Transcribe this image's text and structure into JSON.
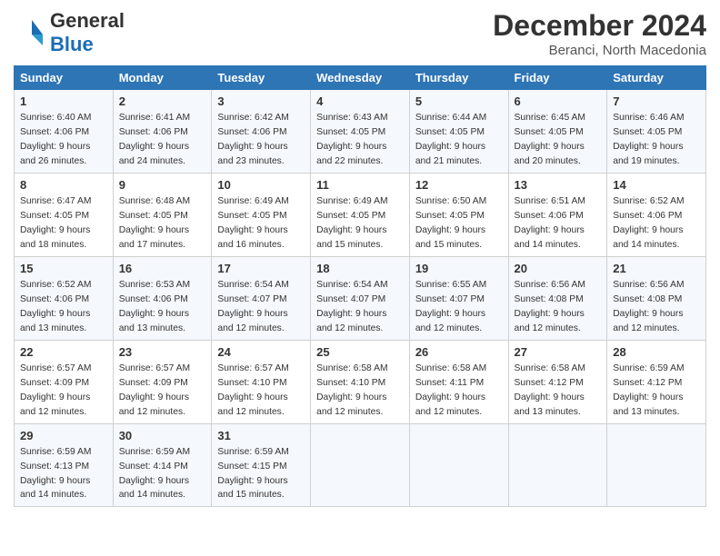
{
  "header": {
    "logo_general": "General",
    "logo_blue": "Blue",
    "month_year": "December 2024",
    "location": "Beranci, North Macedonia"
  },
  "days_of_week": [
    "Sunday",
    "Monday",
    "Tuesday",
    "Wednesday",
    "Thursday",
    "Friday",
    "Saturday"
  ],
  "weeks": [
    [
      {
        "day": "1",
        "sunrise": "Sunrise: 6:40 AM",
        "sunset": "Sunset: 4:06 PM",
        "daylight": "Daylight: 9 hours and 26 minutes."
      },
      {
        "day": "2",
        "sunrise": "Sunrise: 6:41 AM",
        "sunset": "Sunset: 4:06 PM",
        "daylight": "Daylight: 9 hours and 24 minutes."
      },
      {
        "day": "3",
        "sunrise": "Sunrise: 6:42 AM",
        "sunset": "Sunset: 4:06 PM",
        "daylight": "Daylight: 9 hours and 23 minutes."
      },
      {
        "day": "4",
        "sunrise": "Sunrise: 6:43 AM",
        "sunset": "Sunset: 4:05 PM",
        "daylight": "Daylight: 9 hours and 22 minutes."
      },
      {
        "day": "5",
        "sunrise": "Sunrise: 6:44 AM",
        "sunset": "Sunset: 4:05 PM",
        "daylight": "Daylight: 9 hours and 21 minutes."
      },
      {
        "day": "6",
        "sunrise": "Sunrise: 6:45 AM",
        "sunset": "Sunset: 4:05 PM",
        "daylight": "Daylight: 9 hours and 20 minutes."
      },
      {
        "day": "7",
        "sunrise": "Sunrise: 6:46 AM",
        "sunset": "Sunset: 4:05 PM",
        "daylight": "Daylight: 9 hours and 19 minutes."
      }
    ],
    [
      {
        "day": "8",
        "sunrise": "Sunrise: 6:47 AM",
        "sunset": "Sunset: 4:05 PM",
        "daylight": "Daylight: 9 hours and 18 minutes."
      },
      {
        "day": "9",
        "sunrise": "Sunrise: 6:48 AM",
        "sunset": "Sunset: 4:05 PM",
        "daylight": "Daylight: 9 hours and 17 minutes."
      },
      {
        "day": "10",
        "sunrise": "Sunrise: 6:49 AM",
        "sunset": "Sunset: 4:05 PM",
        "daylight": "Daylight: 9 hours and 16 minutes."
      },
      {
        "day": "11",
        "sunrise": "Sunrise: 6:49 AM",
        "sunset": "Sunset: 4:05 PM",
        "daylight": "Daylight: 9 hours and 15 minutes."
      },
      {
        "day": "12",
        "sunrise": "Sunrise: 6:50 AM",
        "sunset": "Sunset: 4:05 PM",
        "daylight": "Daylight: 9 hours and 15 minutes."
      },
      {
        "day": "13",
        "sunrise": "Sunrise: 6:51 AM",
        "sunset": "Sunset: 4:06 PM",
        "daylight": "Daylight: 9 hours and 14 minutes."
      },
      {
        "day": "14",
        "sunrise": "Sunrise: 6:52 AM",
        "sunset": "Sunset: 4:06 PM",
        "daylight": "Daylight: 9 hours and 14 minutes."
      }
    ],
    [
      {
        "day": "15",
        "sunrise": "Sunrise: 6:52 AM",
        "sunset": "Sunset: 4:06 PM",
        "daylight": "Daylight: 9 hours and 13 minutes."
      },
      {
        "day": "16",
        "sunrise": "Sunrise: 6:53 AM",
        "sunset": "Sunset: 4:06 PM",
        "daylight": "Daylight: 9 hours and 13 minutes."
      },
      {
        "day": "17",
        "sunrise": "Sunrise: 6:54 AM",
        "sunset": "Sunset: 4:07 PM",
        "daylight": "Daylight: 9 hours and 12 minutes."
      },
      {
        "day": "18",
        "sunrise": "Sunrise: 6:54 AM",
        "sunset": "Sunset: 4:07 PM",
        "daylight": "Daylight: 9 hours and 12 minutes."
      },
      {
        "day": "19",
        "sunrise": "Sunrise: 6:55 AM",
        "sunset": "Sunset: 4:07 PM",
        "daylight": "Daylight: 9 hours and 12 minutes."
      },
      {
        "day": "20",
        "sunrise": "Sunrise: 6:56 AM",
        "sunset": "Sunset: 4:08 PM",
        "daylight": "Daylight: 9 hours and 12 minutes."
      },
      {
        "day": "21",
        "sunrise": "Sunrise: 6:56 AM",
        "sunset": "Sunset: 4:08 PM",
        "daylight": "Daylight: 9 hours and 12 minutes."
      }
    ],
    [
      {
        "day": "22",
        "sunrise": "Sunrise: 6:57 AM",
        "sunset": "Sunset: 4:09 PM",
        "daylight": "Daylight: 9 hours and 12 minutes."
      },
      {
        "day": "23",
        "sunrise": "Sunrise: 6:57 AM",
        "sunset": "Sunset: 4:09 PM",
        "daylight": "Daylight: 9 hours and 12 minutes."
      },
      {
        "day": "24",
        "sunrise": "Sunrise: 6:57 AM",
        "sunset": "Sunset: 4:10 PM",
        "daylight": "Daylight: 9 hours and 12 minutes."
      },
      {
        "day": "25",
        "sunrise": "Sunrise: 6:58 AM",
        "sunset": "Sunset: 4:10 PM",
        "daylight": "Daylight: 9 hours and 12 minutes."
      },
      {
        "day": "26",
        "sunrise": "Sunrise: 6:58 AM",
        "sunset": "Sunset: 4:11 PM",
        "daylight": "Daylight: 9 hours and 12 minutes."
      },
      {
        "day": "27",
        "sunrise": "Sunrise: 6:58 AM",
        "sunset": "Sunset: 4:12 PM",
        "daylight": "Daylight: 9 hours and 13 minutes."
      },
      {
        "day": "28",
        "sunrise": "Sunrise: 6:59 AM",
        "sunset": "Sunset: 4:12 PM",
        "daylight": "Daylight: 9 hours and 13 minutes."
      }
    ],
    [
      {
        "day": "29",
        "sunrise": "Sunrise: 6:59 AM",
        "sunset": "Sunset: 4:13 PM",
        "daylight": "Daylight: 9 hours and 14 minutes."
      },
      {
        "day": "30",
        "sunrise": "Sunrise: 6:59 AM",
        "sunset": "Sunset: 4:14 PM",
        "daylight": "Daylight: 9 hours and 14 minutes."
      },
      {
        "day": "31",
        "sunrise": "Sunrise: 6:59 AM",
        "sunset": "Sunset: 4:15 PM",
        "daylight": "Daylight: 9 hours and 15 minutes."
      },
      null,
      null,
      null,
      null
    ]
  ]
}
